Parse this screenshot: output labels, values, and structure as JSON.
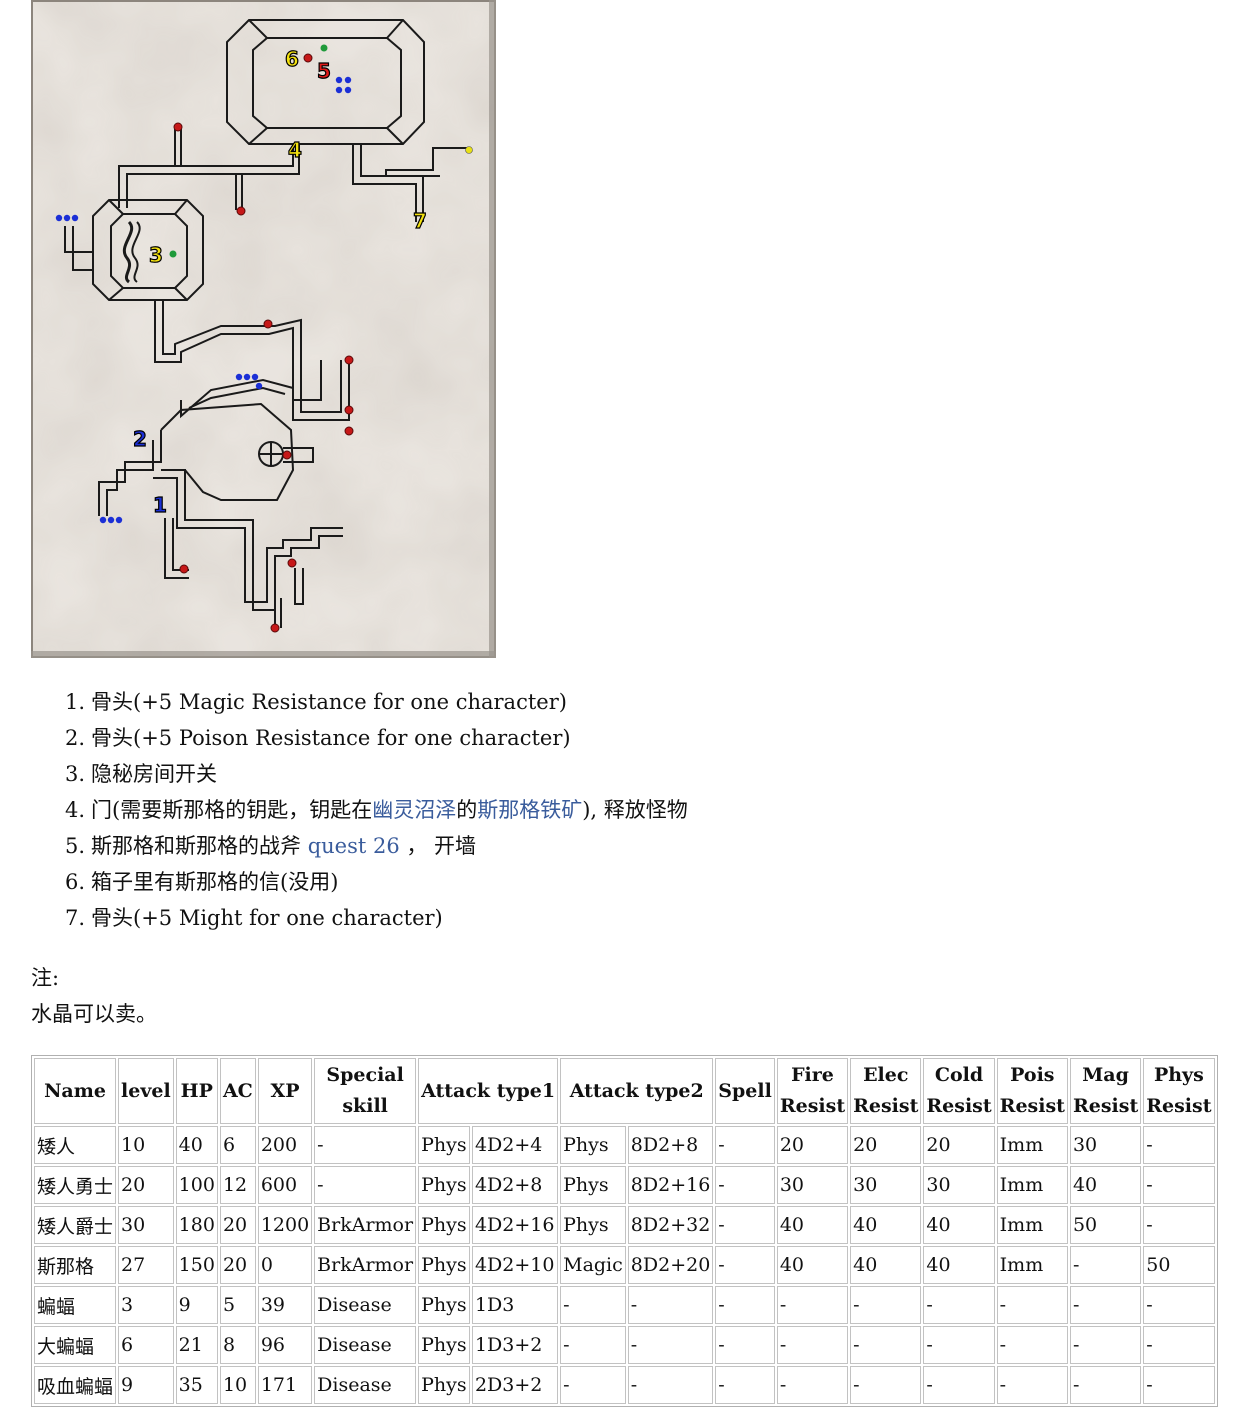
{
  "map": {
    "image": "dungeon-map",
    "markers": [
      {
        "label": "6",
        "color": "#f3e10f"
      },
      {
        "label": "5",
        "color": "#e21a1a"
      },
      {
        "label": "4",
        "color": "#f3e10f"
      },
      {
        "label": "7",
        "color": "#f3e10f"
      },
      {
        "label": "3",
        "color": "#f3e10f"
      },
      {
        "label": "2",
        "color": "#1b2fd6"
      },
      {
        "label": "1",
        "color": "#1b2fd6"
      }
    ]
  },
  "legend": [
    {
      "num": "1.",
      "text": "骨头(+5 Magic Resistance for one character)"
    },
    {
      "num": "2.",
      "text": "骨头(+5 Poison Resistance for one character)"
    },
    {
      "num": "3.",
      "text": "隐秘房间开关"
    },
    {
      "num": "4.",
      "pre": "门(需要斯那格的钥匙，钥匙在",
      "link1": "幽灵沼泽",
      "mid": "的",
      "link2": "斯那格铁矿",
      "post": "), 释放怪物"
    },
    {
      "num": "5.",
      "pre": "斯那格和斯那格的战斧 ",
      "link1": "quest 26",
      "post": " ， 开墙"
    },
    {
      "num": "6.",
      "text": "箱子里有斯那格的信(没用)"
    },
    {
      "num": "7.",
      "text": "骨头(+5 Might for one character)"
    }
  ],
  "note": {
    "label": "注:",
    "text": "水晶可以卖。"
  },
  "table": {
    "headers": [
      {
        "l1": "Name",
        "l2": ""
      },
      {
        "l1": "level",
        "l2": ""
      },
      {
        "l1": "HP",
        "l2": ""
      },
      {
        "l1": "AC",
        "l2": ""
      },
      {
        "l1": "XP",
        "l2": ""
      },
      {
        "l1": "Special",
        "l2": "skill"
      },
      {
        "l1": "Attack type1",
        "l2": ""
      },
      {
        "l1": "Attack type2",
        "l2": ""
      },
      {
        "l1": "Spell",
        "l2": ""
      },
      {
        "l1": "Fire",
        "l2": "Resist"
      },
      {
        "l1": "Elec",
        "l2": "Resist"
      },
      {
        "l1": "Cold",
        "l2": "Resist"
      },
      {
        "l1": "Pois",
        "l2": "Resist"
      },
      {
        "l1": "Mag",
        "l2": "Resist"
      },
      {
        "l1": "Phys",
        "l2": "Resist"
      }
    ],
    "rows": [
      [
        "矮人",
        "10",
        "40",
        "6",
        "200",
        "-",
        "Phys",
        "4D2+4",
        "Phys",
        "8D2+8",
        "-",
        "20",
        "20",
        "20",
        "Imm",
        "30",
        "-"
      ],
      [
        "矮人勇士",
        "20",
        "100",
        "12",
        "600",
        "-",
        "Phys",
        "4D2+8",
        "Phys",
        "8D2+16",
        "-",
        "30",
        "30",
        "30",
        "Imm",
        "40",
        "-"
      ],
      [
        "矮人爵士",
        "30",
        "180",
        "20",
        "1200",
        "BrkArmor",
        "Phys",
        "4D2+16",
        "Phys",
        "8D2+32",
        "-",
        "40",
        "40",
        "40",
        "Imm",
        "50",
        "-"
      ],
      [
        "斯那格",
        "27",
        "150",
        "20",
        "0",
        "BrkArmor",
        "Phys",
        "4D2+10",
        "Magic",
        "8D2+20",
        "-",
        "40",
        "40",
        "40",
        "Imm",
        "-",
        "50"
      ],
      [
        "蝙蝠",
        "3",
        "9",
        "5",
        "39",
        "Disease",
        "Phys",
        "1D3",
        "-",
        "-",
        "-",
        "-",
        "-",
        "-",
        "-",
        "-",
        "-"
      ],
      [
        "大蝙蝠",
        "6",
        "21",
        "8",
        "96",
        "Disease",
        "Phys",
        "1D3+2",
        "-",
        "-",
        "-",
        "-",
        "-",
        "-",
        "-",
        "-",
        "-"
      ],
      [
        "吸血蝙蝠",
        "9",
        "35",
        "10",
        "171",
        "Disease",
        "Phys",
        "2D3+2",
        "-",
        "-",
        "-",
        "-",
        "-",
        "-",
        "-",
        "-",
        "-"
      ]
    ]
  }
}
